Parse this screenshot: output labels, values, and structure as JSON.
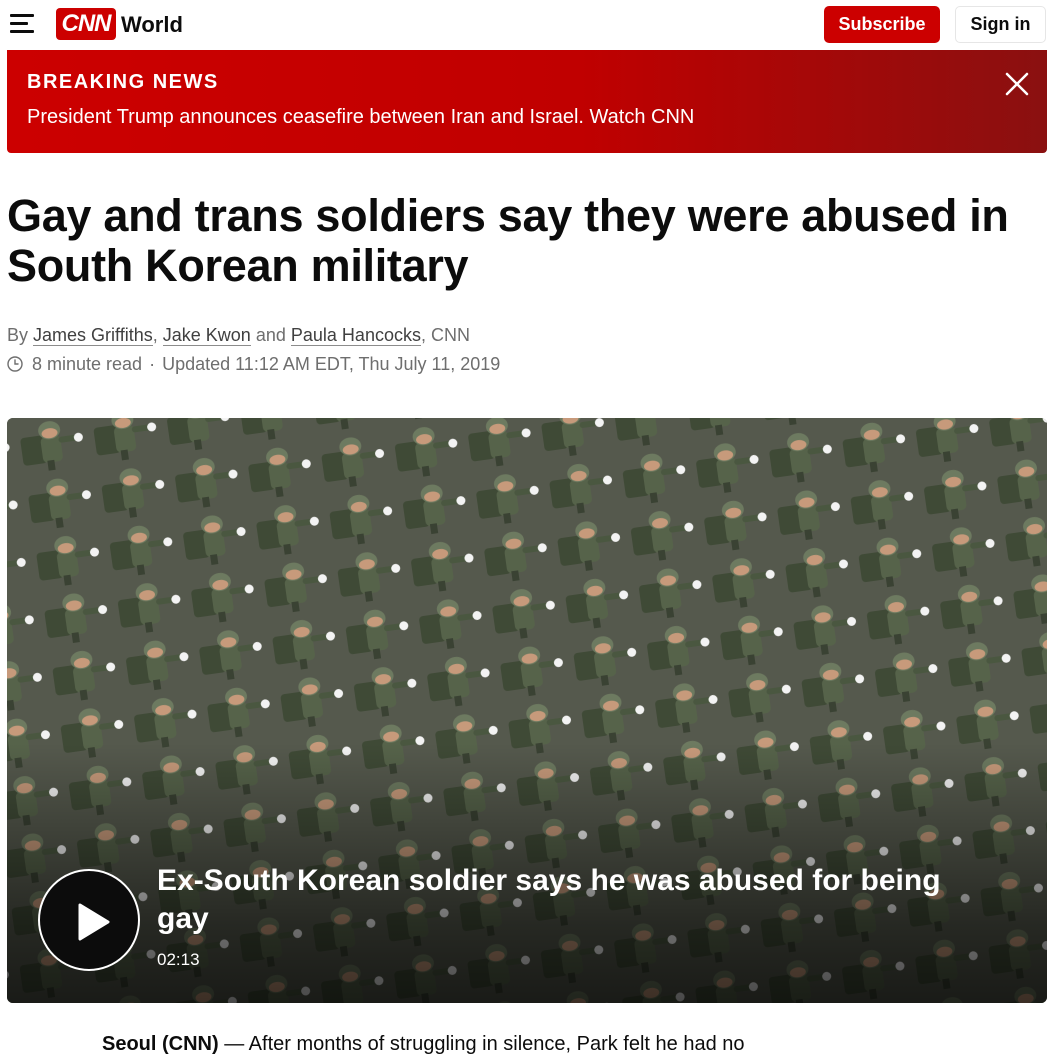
{
  "header": {
    "menu_icon": "hamburger-menu-icon",
    "logo_text": "CNN",
    "section": "World",
    "subscribe_label": "Subscribe",
    "signin_label": "Sign in"
  },
  "breaking": {
    "label": "BREAKING NEWS",
    "text": "President Trump announces ceasefire between Iran and Israel. Watch CNN",
    "close_icon": "close-icon"
  },
  "article": {
    "headline": "Gay and trans soldiers say they were abused in South Korean military",
    "byline_prefix": "By",
    "authors": [
      "James Griffiths",
      "Jake Kwon",
      "Paula Hancocks"
    ],
    "byline_and": "and",
    "byline_outlet": ", CNN",
    "read_time": "8 minute read",
    "updated": "Updated 11:12 AM EDT, Thu July 11, 2019"
  },
  "video": {
    "title": "Ex-South Korean soldier says he was abused for being gay",
    "duration": "02:13",
    "play_icon": "play-icon"
  },
  "body": {
    "dateline": "Seoul (CNN)",
    "first_text": " — After months of struggling in silence, Park felt he had no"
  },
  "colors": {
    "brand_red": "#cc0000",
    "breaking_dark": "#8a1010",
    "text": "#0c0c0c",
    "meta_gray": "#6e6e6e"
  }
}
